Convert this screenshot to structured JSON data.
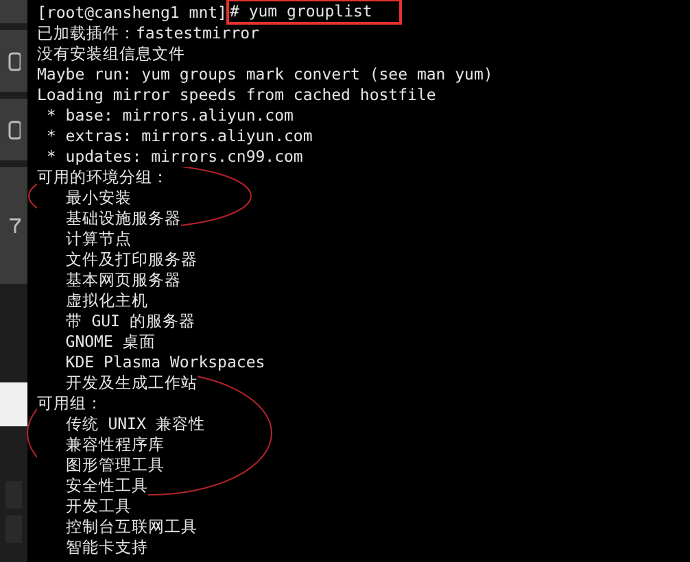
{
  "terminal": {
    "prompt": "[root@cansheng1 mnt]",
    "command": "# yum grouplist",
    "lines": [
      "已加载插件：fastestmirror",
      "没有安装组信息文件",
      "Maybe run: yum groups mark convert (see man yum)",
      "Loading mirror speeds from cached hostfile",
      " * base: mirrors.aliyun.com",
      " * extras: mirrors.aliyun.com",
      " * updates: mirrors.cn99.com",
      "可用的环境分组：",
      "   最小安装",
      "   基础设施服务器",
      "   计算节点",
      "   文件及打印服务器",
      "   基本网页服务器",
      "   虚拟化主机",
      "   带 GUI 的服务器",
      "   GNOME 桌面",
      "   KDE Plasma Workspaces",
      "   开发及生成工作站",
      "可用组：",
      "   传统 UNIX 兼容性",
      "   兼容性程序库",
      "   图形管理工具",
      "   安全性工具",
      "   开发工具",
      "   控制台互联网工具",
      "   智能卡支持"
    ]
  }
}
